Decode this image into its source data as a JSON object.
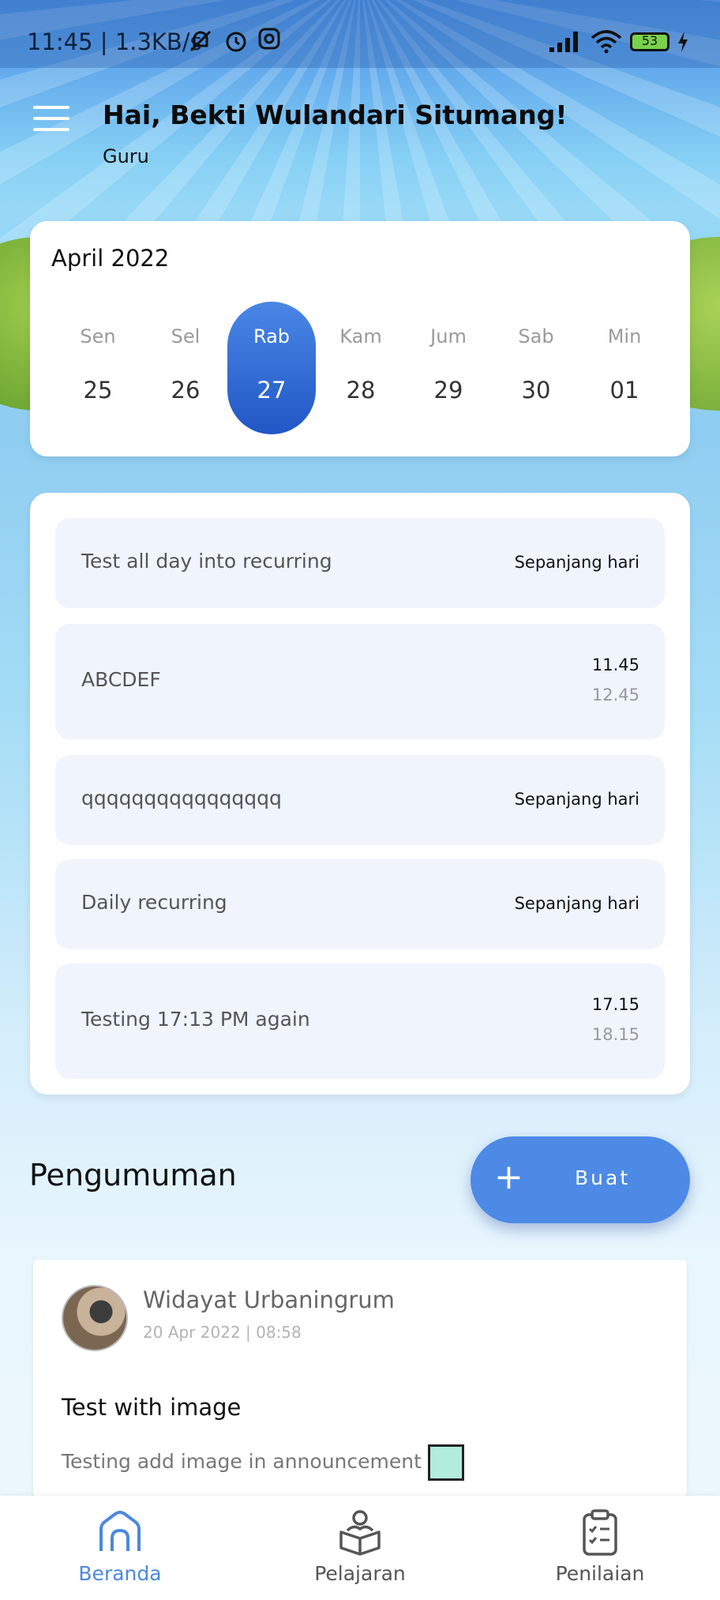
{
  "status_bar": {
    "time": "11:45 | 1.3KB/s",
    "battery": "53",
    "icons": [
      "mute-bell-icon",
      "alarm-icon",
      "instagram-icon",
      "signal-icon",
      "wifi-icon",
      "battery-icon",
      "charging-icon"
    ]
  },
  "header": {
    "greeting": "Hai, Bekti Wulandari Situmang!",
    "role": "Guru"
  },
  "calendar": {
    "month": "April 2022",
    "days": [
      {
        "name": "Sen",
        "date": "25"
      },
      {
        "name": "Sel",
        "date": "26"
      },
      {
        "name": "Rab",
        "date": "27"
      },
      {
        "name": "Kam",
        "date": "28"
      },
      {
        "name": "Jum",
        "date": "29"
      },
      {
        "name": "Sab",
        "date": "30"
      },
      {
        "name": "Min",
        "date": "01"
      }
    ],
    "selected": "Rab"
  },
  "events": [
    {
      "title": "Test all day into recurring",
      "time": "Sepanjang hari"
    },
    {
      "title": "ABCDEF",
      "start": "11.45",
      "end": "12.45"
    },
    {
      "title": "qqqqqqqqqqqqqqqq",
      "time": "Sepanjang hari"
    },
    {
      "title": "Daily recurring",
      "time": "Sepanjang hari"
    },
    {
      "title": "Testing 17:13 PM again",
      "start": "17.15",
      "end": "18.15"
    }
  ],
  "announcements": {
    "title": "Pengumuman",
    "create_label": "Buat",
    "items": [
      {
        "author": "Widayat Urbaningrum",
        "date": "20 Apr 2022 | 08:58",
        "heading": "Test with image",
        "body": "Testing add image in announcement"
      }
    ]
  },
  "bottom_nav": {
    "items": [
      {
        "label": "Beranda",
        "icon": "home-icon"
      },
      {
        "label": "Pelajaran",
        "icon": "reading-icon"
      },
      {
        "label": "Penilaian",
        "icon": "clipboard-icon"
      }
    ],
    "active": "Beranda"
  },
  "colors": {
    "accent": "#4d8ae6",
    "selected_day": "#2f68d4",
    "event_bg": "#eff4fd",
    "active_nav": "#4b88e0"
  }
}
